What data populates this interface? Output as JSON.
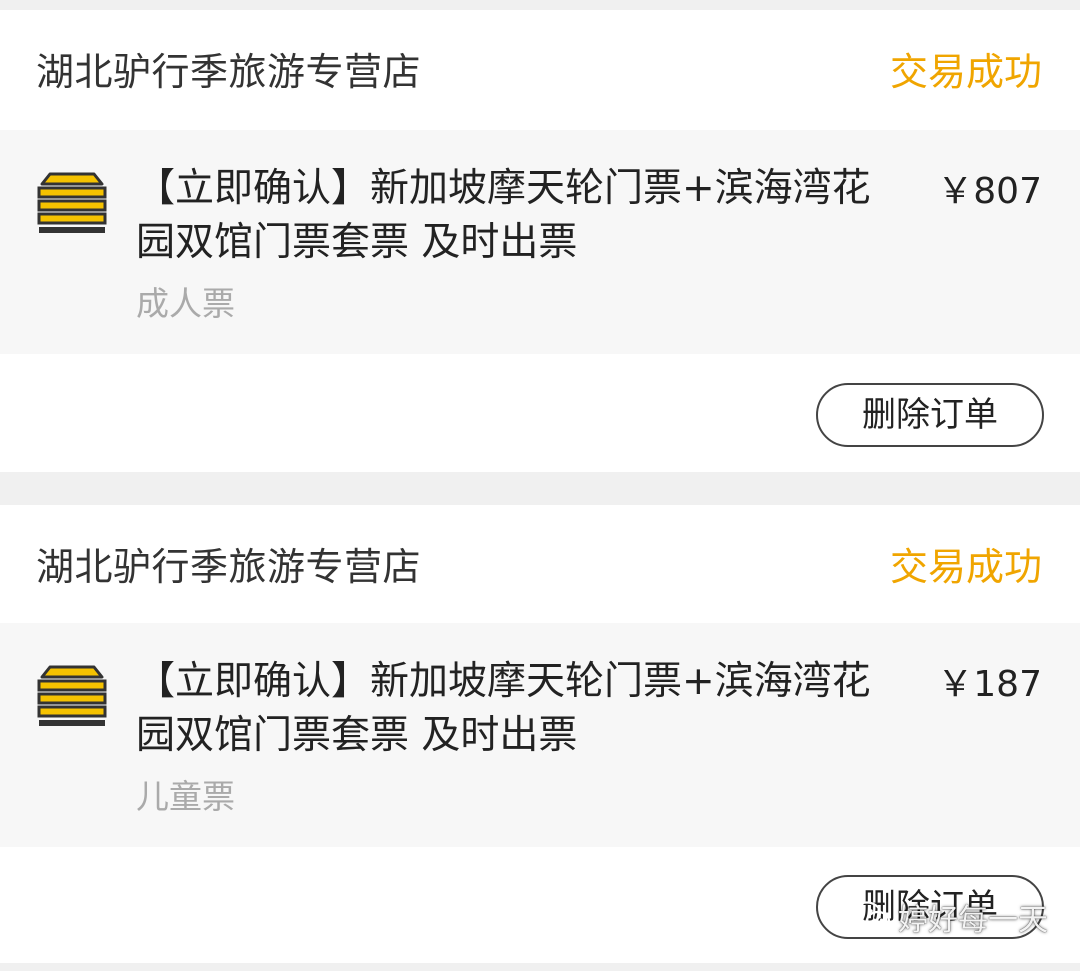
{
  "orders": [
    {
      "store_name": "湖北驴行季旅游专营店",
      "status": "交易成功",
      "item": {
        "icon": "ticket-store-icon",
        "title": "【立即确认】新加坡摩天轮门票+滨海湾花园双馆门票套票 及时出票",
        "price": "￥807",
        "spec": "成人票"
      },
      "delete_label": "删除订单"
    },
    {
      "store_name": "湖北驴行季旅游专营店",
      "status": "交易成功",
      "item": {
        "icon": "ticket-store-icon",
        "title": "【立即确认】新加坡摩天轮门票+滨海湾花园双馆门票套票 及时出票",
        "price": "￥187",
        "spec": "儿童票"
      },
      "delete_label": "删除订单"
    }
  ],
  "watermark": {
    "icon": "wechat-icon",
    "text": "婷好每一天"
  },
  "colors": {
    "status": "#f0a500",
    "icon_yellow": "#f5c200",
    "background": "#f0f0f0"
  }
}
